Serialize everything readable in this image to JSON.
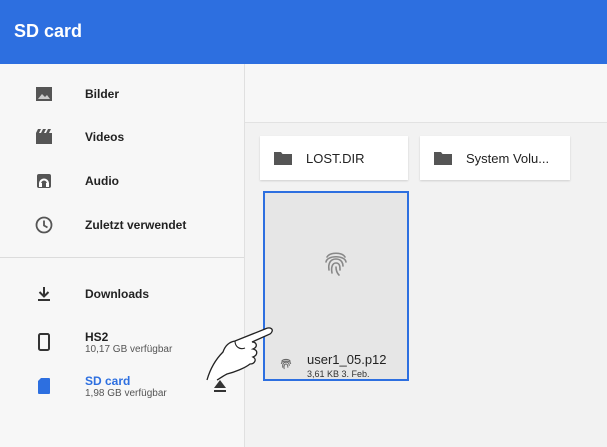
{
  "appbar": {
    "title": "SD card",
    "color": "#2d6fe0"
  },
  "drawer": {
    "items": [
      {
        "label": "Bilder",
        "icon": "image-icon"
      },
      {
        "label": "Videos",
        "icon": "film-icon"
      },
      {
        "label": "Audio",
        "icon": "music-icon"
      },
      {
        "label": "Zuletzt verwendet",
        "icon": "clock-icon"
      }
    ],
    "devices": [
      {
        "label": "Downloads",
        "icon": "download-icon"
      },
      {
        "label": "HS2",
        "sub": "10,17 GB verfügbar",
        "icon": "phone-icon"
      },
      {
        "label": "SD card",
        "sub": "1,98 GB verfügbar",
        "icon": "sd-card-icon",
        "active": true
      }
    ]
  },
  "folders": [
    {
      "name": "LOST.DIR",
      "icon": "folder-icon"
    },
    {
      "name": "System Volu...",
      "icon": "folder-icon"
    }
  ],
  "file": {
    "name": "user1_05.p12",
    "meta": "3,61 KB 3. Feb.",
    "icon": "fingerprint-icon"
  }
}
